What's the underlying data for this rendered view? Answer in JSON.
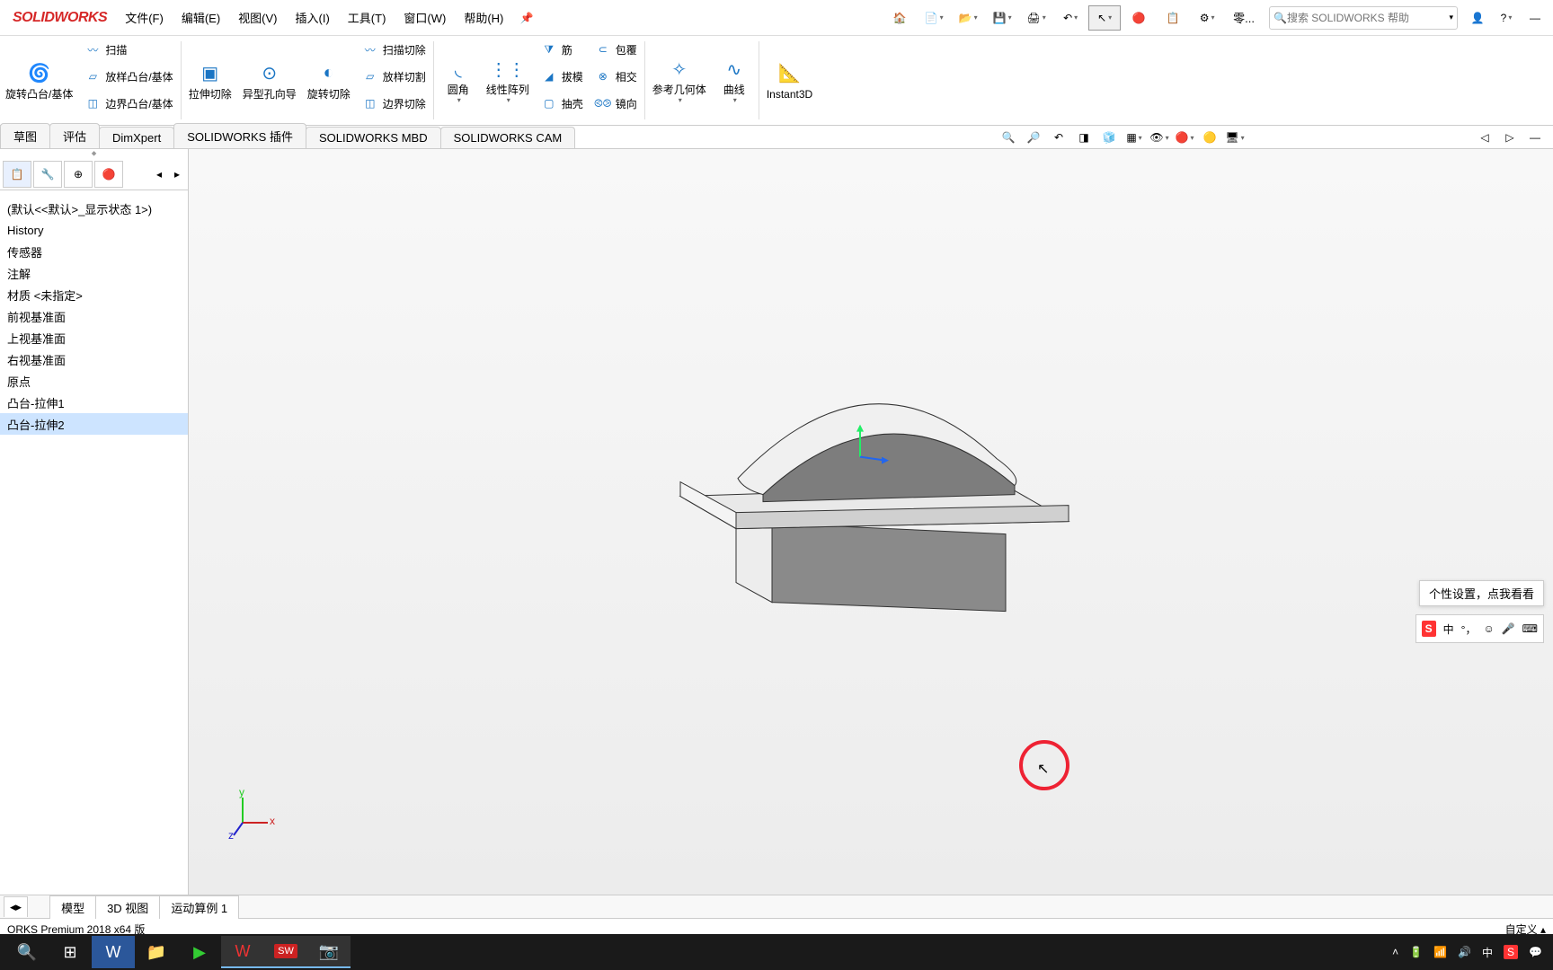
{
  "app": {
    "logo": "SOLIDWORKS"
  },
  "menu": {
    "file": "文件(F)",
    "edit": "编辑(E)",
    "view": "视图(V)",
    "insert": "插入(I)",
    "tools": "工具(T)",
    "window": "窗口(W)",
    "help": "帮助(H)",
    "part": "零..."
  },
  "search": {
    "placeholder": "搜索 SOLIDWORKS 帮助"
  },
  "ribbon": {
    "revolve": "旋转凸台/基体",
    "sweep": "扫描",
    "loft": "放样凸台/基体",
    "boundary": "边界凸台/基体",
    "extcut": "拉伸切除",
    "holewiz": "异型孔向导",
    "revcut": "旋转切除",
    "sweepcut": "扫描切除",
    "loftcut": "放样切割",
    "boundcut": "边界切除",
    "fillet": "圆角",
    "linpat": "线性阵列",
    "rib": "筋",
    "draft": "拔模",
    "shell": "抽壳",
    "wrap": "包覆",
    "intersect": "相交",
    "mirror": "镜向",
    "refgeom": "参考几何体",
    "curves": "曲线",
    "instant3d": "Instant3D"
  },
  "tabs": {
    "sketch": "草图",
    "evaluate": "评估",
    "dimxpert": "DimXpert",
    "addins": "SOLIDWORKS 插件",
    "mbd": "SOLIDWORKS MBD",
    "cam": "SOLIDWORKS CAM"
  },
  "tree": {
    "config": "(默认<<默认>_显示状态 1>)",
    "history": "History",
    "sensors": "传感器",
    "annotations": "注解",
    "material": "材质 <未指定>",
    "front": "前视基准面",
    "top": "上视基准面",
    "right": "右视基准面",
    "origin": "原点",
    "ext1": "凸台-拉伸1",
    "ext2": "凸台-拉伸2"
  },
  "ime": {
    "tip": "个性设置，点我看看",
    "mid": "中"
  },
  "bottomtabs": {
    "model": "模型",
    "view3d": "3D 视图",
    "motion": "运动算例 1"
  },
  "status": {
    "version": "ORKS Premium 2018 x64 版",
    "custom": "自定义"
  },
  "tray": {
    "ime2": "中"
  }
}
